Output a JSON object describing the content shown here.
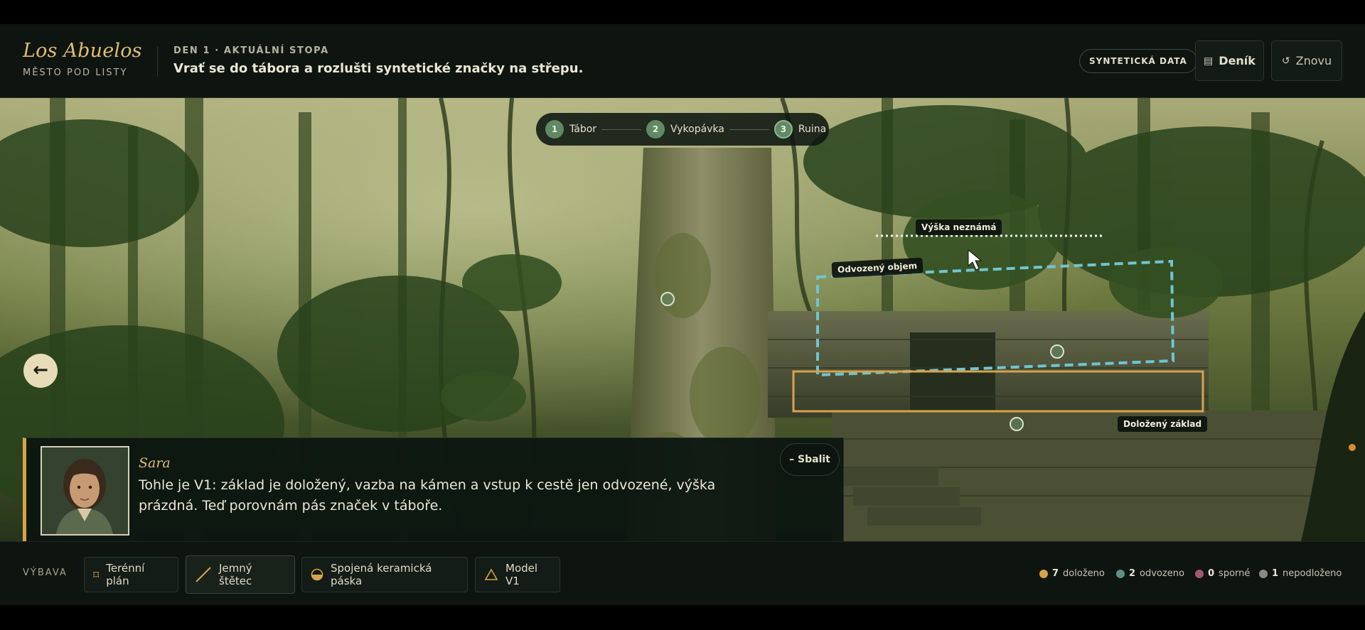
{
  "header": {
    "brand_title": "Los Abuelos",
    "brand_subtitle": "MĚSTO POD LISTY",
    "day_label": "DEN 1 · AKTUÁLNÍ STOPA",
    "quest": "Vrať se do tábora a rozlušti syntetické značky na střepu.",
    "pill": "SYNTETICKÁ DATA",
    "journal_label": "Deník",
    "restart_label": "Znovu"
  },
  "stepper": [
    {
      "num": "1",
      "label": "Tábor"
    },
    {
      "num": "2",
      "label": "Vykopávka"
    },
    {
      "num": "3",
      "label": "Ruina",
      "active": true
    }
  ],
  "scene": {
    "height_label": "Výška neznámá",
    "derived_label": "Odvozený objem",
    "base_label": "Doložený základ"
  },
  "dialog": {
    "speaker": "Sara",
    "text": "Tohle je V1: základ je doložený, vazba na kámen a vstup k cestě jen odvozené, výška prázdná. Teď porovnám pás značek v táboře.",
    "collapse_label": "– Sbalit"
  },
  "footer": {
    "gear_label": "VÝBAVA",
    "tools": [
      {
        "label": "Terénní plán",
        "icon": "map-icon"
      },
      {
        "label": "Jemný štětec",
        "icon": "brush-icon"
      },
      {
        "label": "Spojená keramická páska",
        "icon": "ceramic-icon"
      },
      {
        "label": "Model V1",
        "icon": "triangle-icon"
      }
    ],
    "legend": [
      {
        "count": "7",
        "label": "doloženo",
        "color": "#d9a24a"
      },
      {
        "count": "2",
        "label": "odvozeno",
        "color": "#5f8f88"
      },
      {
        "count": "0",
        "label": "sporné",
        "color": "#a05a72"
      },
      {
        "count": "1",
        "label": "nepodloženo",
        "color": "#8a8a84"
      }
    ]
  },
  "colors": {
    "accent_gold": "#d9a24a",
    "derived_cyan": "#6fc6d0",
    "step_green": "#5f8a64"
  }
}
